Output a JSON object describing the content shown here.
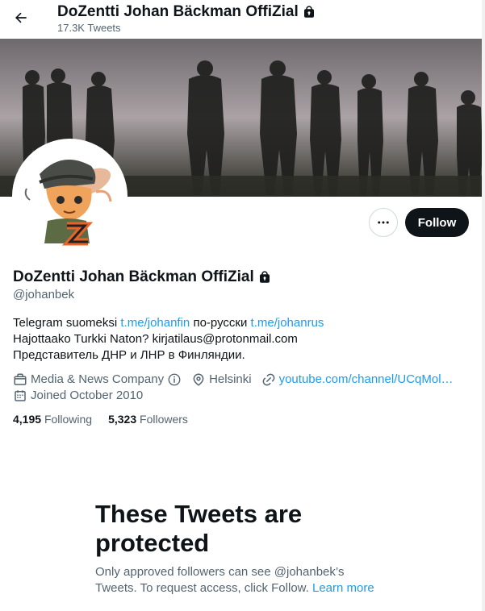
{
  "header": {
    "title": "DoZentti Johan Bäckman OffiZial",
    "tweet_count": "17.3K Tweets"
  },
  "profile": {
    "display_name": "DoZentti Johan Bäckman OffiZial",
    "handle": "@johanbek",
    "bio": {
      "line1_text1": "Telegram suomeksi ",
      "line1_link1": "t.me/johanfin",
      "line1_text2": " по-русски ",
      "line1_link2": "t.me/johanrus",
      "line2": "Hajottaako Turkki Naton? kirjatilaus@protonmail.com",
      "line3": "Представитель ДНР и ЛНР в Финляндии."
    },
    "category": "Media & News Company",
    "location": "Helsinki",
    "website": "youtube.com/channel/UCqMol…",
    "joined": "Joined October 2010",
    "following_count": "4,195",
    "following_label": "Following",
    "followers_count": "5,323",
    "followers_label": "Followers"
  },
  "actions": {
    "follow_label": "Follow"
  },
  "protected": {
    "title": "These Tweets are protected",
    "text": "Only approved followers can see @johanbek’s Tweets. To request access, click Follow. ",
    "learn_more": "Learn more"
  },
  "colors": {
    "accent": "#1d9bf0",
    "text_primary": "#0f1419",
    "text_secondary": "#536471",
    "follow_bg": "#0f1419"
  }
}
